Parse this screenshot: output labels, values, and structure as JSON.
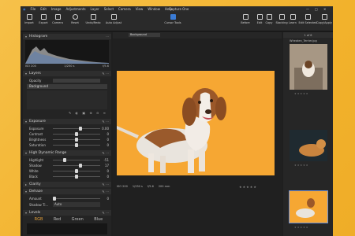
{
  "window": {
    "title": "Capture One",
    "menu": [
      "File",
      "Edit",
      "Image",
      "Adjustments",
      "Layer",
      "Select",
      "Camera",
      "View",
      "Window",
      "Help"
    ],
    "controls": [
      "—",
      "□",
      "✕"
    ]
  },
  "toolbar": {
    "left": [
      "Import",
      "Export",
      "Camera"
    ],
    "mid": [
      "Reset",
      "Undo/Redo"
    ],
    "auto": "Auto Adjust",
    "cursor": "Cursor Tools",
    "right": [
      "Before",
      "Edit",
      "Copy",
      "Stacking",
      "Learn",
      "Edit Selected",
      "Copy/Apply"
    ]
  },
  "left_panel": {
    "histogram_title": "Histogram",
    "histogram_meta": [
      "ISO 200",
      "1/250 s",
      "f/5.6"
    ],
    "layers_title": "Layers",
    "opacity_label": "Opacity",
    "opacity_value": "",
    "layer_name": "Background",
    "exposure_title": "Exposure",
    "exposure_rows": [
      {
        "label": "Exposure",
        "value": "0.00",
        "pos": 0.55
      },
      {
        "label": "Contrast",
        "value": "0",
        "pos": 0.5
      },
      {
        "label": "Brightness",
        "value": "0",
        "pos": 0.5
      },
      {
        "label": "Saturation",
        "value": "0",
        "pos": 0.5
      }
    ],
    "hdr_title": "High Dynamic Range",
    "hdr_rows": [
      {
        "label": "Highlight",
        "value": "-51",
        "pos": 0.25
      },
      {
        "label": "Shadow",
        "value": "17",
        "pos": 0.58
      },
      {
        "label": "White",
        "value": "0",
        "pos": 0.5
      },
      {
        "label": "Black",
        "value": "0",
        "pos": 0.5
      }
    ],
    "clarity_title": "Clarity",
    "dehaze_title": "Dehaze",
    "dehaze_rows": [
      {
        "label": "Amount",
        "value": "0",
        "pos": 0.0
      },
      {
        "label": "Shadow Ti...",
        "value": "Auto",
        "pos": 0.0
      }
    ],
    "levels_title": "Levels",
    "levels_tabs": [
      "RGB",
      "Red",
      "Green",
      "Blue"
    ]
  },
  "viewer": {
    "dropdown": "Background",
    "fileinfo": [
      "ISO 200",
      "1/250 s",
      "f/5.6",
      "200 mm"
    ]
  },
  "browser": {
    "count": "1 of 6",
    "filename": "Wheaten_Terrier.jpg"
  }
}
